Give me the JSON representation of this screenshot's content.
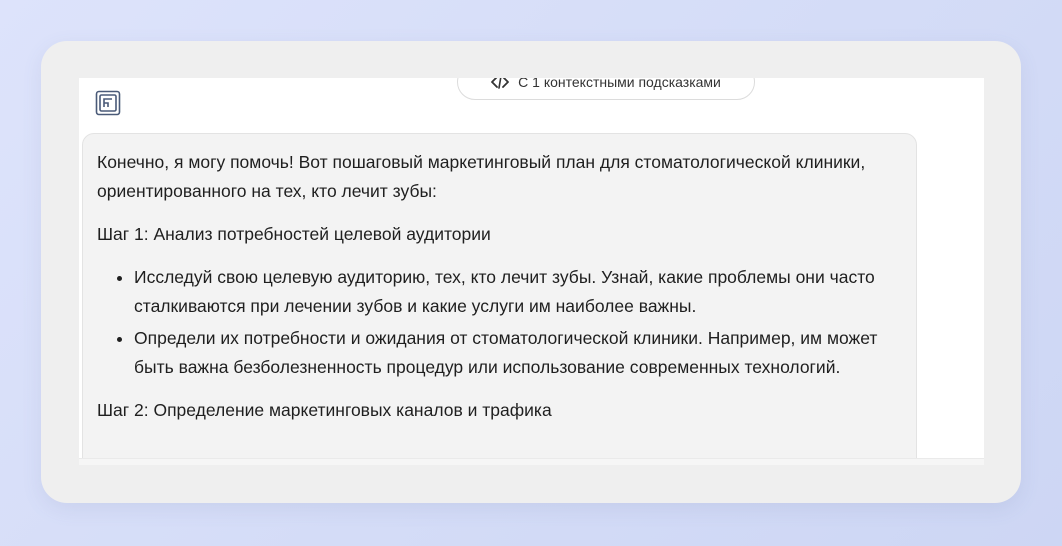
{
  "hint": {
    "icon": "context-hints-icon",
    "label": "С 1 контекстными подсказками"
  },
  "logo": {
    "icon": "app-logo-icon"
  },
  "message": {
    "intro": "Конечно, я могу помочь! Вот пошаговый маркетинговый план для стоматологической клиники, ориентированного на тех, кто лечит зубы:",
    "step1_title": "Шаг 1: Анализ потребностей целевой аудитории",
    "step1_items": [
      "Исследуй свою целевую аудиторию, тех, кто лечит зубы. Узнай, какие проблемы они часто сталкиваются при лечении зубов и какие услуги им наиболее важны.",
      "Определи их потребности и ожидания от стоматологической клиники. Например, им может быть важна безболезненность процедур или использование современных технологий."
    ],
    "step2_title": "Шаг 2: Определение маркетинговых каналов и трафика"
  }
}
